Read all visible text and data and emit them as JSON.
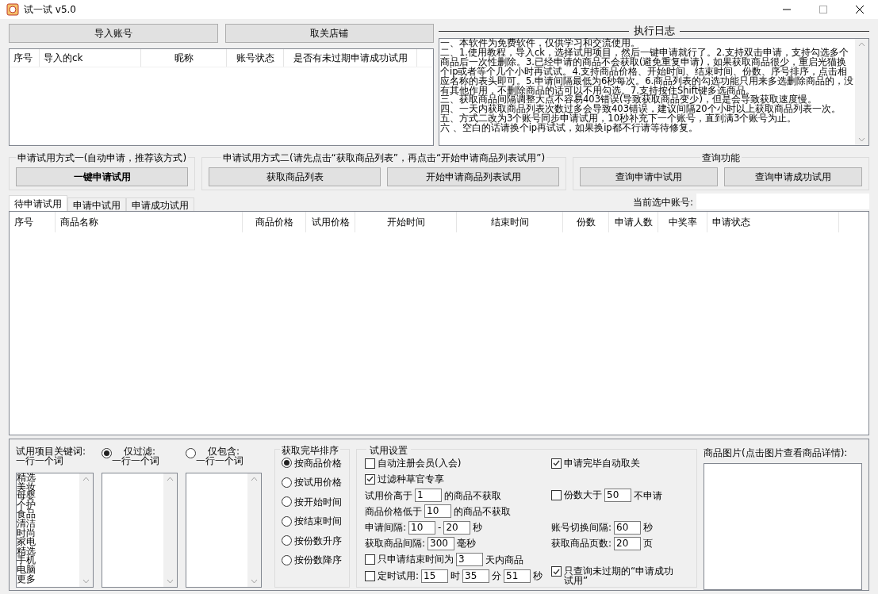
{
  "window": {
    "title": "试一试 v5.0"
  },
  "top_buttons": [
    "导入账号",
    "取关店铺"
  ],
  "accounts_table": {
    "columns": [
      "序号",
      "导入的ck",
      "昵称",
      "账号状态",
      "是否有未过期申请成功试用"
    ]
  },
  "log": {
    "title": "执行日志",
    "lines": [
      "一、本软件为免费软件，仅供学习和交流使用。",
      "二、1.使用教程，导入ck，选择试用项目，然后一键申请就行了。2.支持双击申请，支持勾选多个商品后一次性删除。3.已经申请的商品不会获取(避免重复申请)，如果获取商品很少，重启光猫换个ip或者等个几个小时再试试。4.支持商品价格、开始时间、结束时间、份数、序号排序，点击相应名称的表头即可。5.申请间隔最低为6秒每次。6.商品列表的勾选功能只用来多选删除商品的，没有其他作用，不删除商品的话可以不用勾选。7.支持按住Shift键多选商品。",
      "三、获取商品间隔调整大点不容易403错误(导致获取商品变少)，但是会导致获取速度慢。",
      "四、一天内获取商品列表次数过多会导致403错误，建议间隔20个小时以上获取商品列表一次。",
      "五、方式二改为3个账号同步申请试用，10秒补充下一个账号，直到满3个账号为止。",
      "六 、空白的话请换个ip再试试，如果换ip都不行请等待修复。"
    ]
  },
  "groups": [
    {
      "title": "申请试用方式一(自动申请，推荐该方式)",
      "buttons": [
        {
          "label": "一键申请试用",
          "bold": true
        }
      ]
    },
    {
      "title": "申请试用方式二(请先点击“获取商品列表”，再点击“开始申请商品列表试用”)",
      "buttons": [
        {
          "label": "获取商品列表",
          "bold": false
        },
        {
          "label": "开始申请商品列表试用",
          "bold": false
        }
      ]
    },
    {
      "title": "查询功能",
      "buttons": [
        {
          "label": "查询申请中试用",
          "bold": false
        },
        {
          "label": "查询申请成功试用",
          "bold": false
        }
      ]
    }
  ],
  "tabs": [
    {
      "label": "待申请试用",
      "selected": true
    },
    {
      "label": "申请中试用",
      "selected": false
    },
    {
      "label": "申请成功试用",
      "selected": false
    }
  ],
  "current_account": {
    "label": "当前选中账号:"
  },
  "products_table": {
    "columns": [
      "序号",
      "商品名称",
      "商品价格",
      "试用价格",
      "开始时间",
      "结束时间",
      "份数",
      "申请人数",
      "中奖率",
      "申请状态"
    ]
  },
  "keywords": {
    "label": "试用项目关键词:",
    "hint": "一行一个词",
    "items": [
      "精选",
      "美妆",
      "母婴",
      "个护",
      "食品",
      "清洁",
      "时尚",
      "家电",
      "精选",
      "手机",
      "电脑",
      "更多"
    ]
  },
  "filter_modes": [
    {
      "label": "仅过滤:",
      "hint": "一行一个词",
      "selected": true
    },
    {
      "label": "仅包含:",
      "hint": "一行一个词",
      "selected": false
    }
  ],
  "sort": {
    "title": "获取完毕排序",
    "options": [
      {
        "label": "按商品价格",
        "selected": true
      },
      {
        "label": "按试用价格",
        "selected": false
      },
      {
        "label": "按开始时间",
        "selected": false
      },
      {
        "label": "按结束时间",
        "selected": false
      },
      {
        "label": "按份数升序",
        "selected": false
      },
      {
        "label": "按份数降序",
        "selected": false
      }
    ]
  },
  "settings": {
    "title": "试用设置",
    "rows": [
      {
        "left": [
          {
            "kind": "check",
            "label": "自动注册会员(入会)",
            "checked": false
          }
        ],
        "right": [
          {
            "kind": "check",
            "label": "申请完毕自动取关",
            "checked": true
          }
        ]
      },
      {
        "left": [
          {
            "kind": "check",
            "label": "过滤种草官专享",
            "checked": true
          }
        ]
      },
      {
        "left": [
          {
            "kind": "text",
            "text": "试用价高于"
          },
          {
            "kind": "field",
            "value": "1"
          },
          {
            "kind": "text",
            "text": "的商品不获取"
          }
        ],
        "right": [
          {
            "kind": "check",
            "label": "份数大于",
            "checked": false
          },
          {
            "kind": "field",
            "value": "50"
          },
          {
            "kind": "text",
            "text": "不申请"
          }
        ]
      },
      {
        "left": [
          {
            "kind": "text",
            "text": "商品价格低于"
          },
          {
            "kind": "field",
            "value": "10"
          },
          {
            "kind": "text",
            "text": "的商品不获取"
          }
        ]
      },
      {
        "left": [
          {
            "kind": "text",
            "text": "申请间隔:"
          },
          {
            "kind": "field",
            "value": "10"
          },
          {
            "kind": "text",
            "text": "-"
          },
          {
            "kind": "field",
            "value": "20"
          },
          {
            "kind": "text",
            "text": "秒"
          }
        ],
        "right": [
          {
            "kind": "text",
            "text": "账号切换间隔:"
          },
          {
            "kind": "field",
            "value": "60"
          },
          {
            "kind": "text",
            "text": "秒"
          }
        ]
      },
      {
        "left": [
          {
            "kind": "text",
            "text": "获取商品间隔:"
          },
          {
            "kind": "field",
            "value": "300"
          },
          {
            "kind": "text",
            "text": "毫秒"
          }
        ],
        "right": [
          {
            "kind": "text",
            "text": "获取商品页数:"
          },
          {
            "kind": "field",
            "value": "20"
          },
          {
            "kind": "text",
            "text": "页"
          }
        ]
      },
      {
        "left": [
          {
            "kind": "check",
            "label": "只申请结束时间为",
            "checked": false
          },
          {
            "kind": "field",
            "value": "3"
          },
          {
            "kind": "text",
            "text": "天内商品"
          }
        ]
      },
      {
        "left": [
          {
            "kind": "check",
            "label": "定时试用:",
            "checked": false
          },
          {
            "kind": "field",
            "value": "15"
          },
          {
            "kind": "text",
            "text": "时"
          },
          {
            "kind": "field",
            "value": "35"
          },
          {
            "kind": "text",
            "text": "分"
          },
          {
            "kind": "field",
            "value": "51"
          },
          {
            "kind": "text",
            "text": "秒"
          }
        ],
        "right": [
          {
            "kind": "check",
            "label": "只查询未过期的“申请成功试用”",
            "checked": true
          }
        ]
      }
    ]
  },
  "image_panel": {
    "label": "商品图片(点击图片查看商品详情):"
  }
}
